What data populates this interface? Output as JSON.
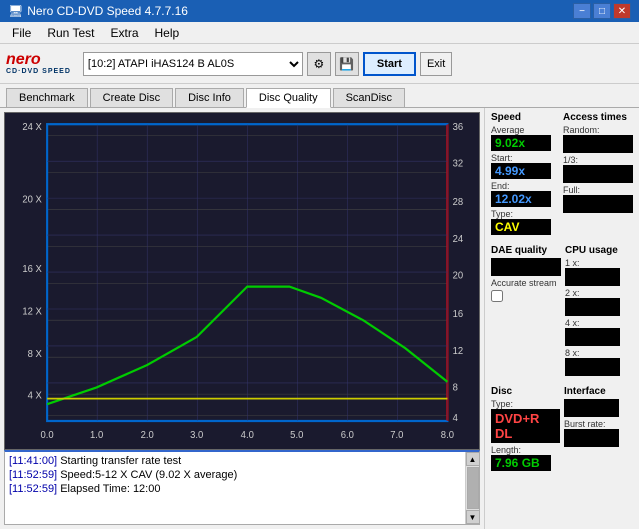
{
  "titleBar": {
    "title": "Nero CD-DVD Speed 4.7.7.16",
    "minimize": "−",
    "maximize": "□",
    "close": "✕"
  },
  "menuBar": {
    "items": [
      "File",
      "Run Test",
      "Extra",
      "Help"
    ]
  },
  "toolbar": {
    "logoTop": "nero",
    "logoBottom": "CD·DVD SPEED",
    "driveLabel": "[10:2]  ATAPI iHAS124  B AL0S",
    "startLabel": "Start",
    "exitLabel": "Exit"
  },
  "tabs": [
    "Benchmark",
    "Create Disc",
    "Disc Info",
    "Disc Quality",
    "ScanDisc"
  ],
  "activeTab": "Disc Quality",
  "chart": {
    "yAxisLeft": [
      "24 X",
      "20 X",
      "16 X",
      "12 X",
      "8 X",
      "4 X"
    ],
    "yAxisRight": [
      "36",
      "32",
      "28",
      "24",
      "20",
      "16",
      "12",
      "8",
      "4"
    ],
    "xAxis": [
      "0.0",
      "1.0",
      "2.0",
      "3.0",
      "4.0",
      "5.0",
      "6.0",
      "7.0",
      "8.0"
    ]
  },
  "rightPanel": {
    "speedSection": "Speed",
    "averageLabel": "Average",
    "averageValue": "9.02x",
    "startLabel": "Start:",
    "startValue": "4.99x",
    "endLabel": "End:",
    "endValue": "12.02x",
    "typeLabel": "Type:",
    "typeValue": "CAV",
    "accessTimesLabel": "Access times",
    "randomLabel": "Random:",
    "oneThirdLabel": "1/3:",
    "fullLabel": "Full:",
    "cpuLabel": "CPU usage",
    "cpu1xLabel": "1 x:",
    "cpu2xLabel": "2 x:",
    "cpu4xLabel": "4 x:",
    "cpu8xLabel": "8 x:",
    "daeLabel": "DAE quality",
    "accurateLabel": "Accurate stream",
    "discLabel": "Disc Type:",
    "discType": "DVD+R DL",
    "lengthLabel": "Length:",
    "lengthValue": "7.96 GB",
    "interfaceLabel": "Interface",
    "burstLabel": "Burst rate:"
  },
  "log": {
    "entries": [
      {
        "time": "[11:41:00]",
        "text": "Starting transfer rate test"
      },
      {
        "time": "[11:52:59]",
        "text": "Speed:5-12 X CAV (9.02 X average)"
      },
      {
        "time": "[11:52:59]",
        "text": "Elapsed Time: 12:00"
      }
    ]
  }
}
